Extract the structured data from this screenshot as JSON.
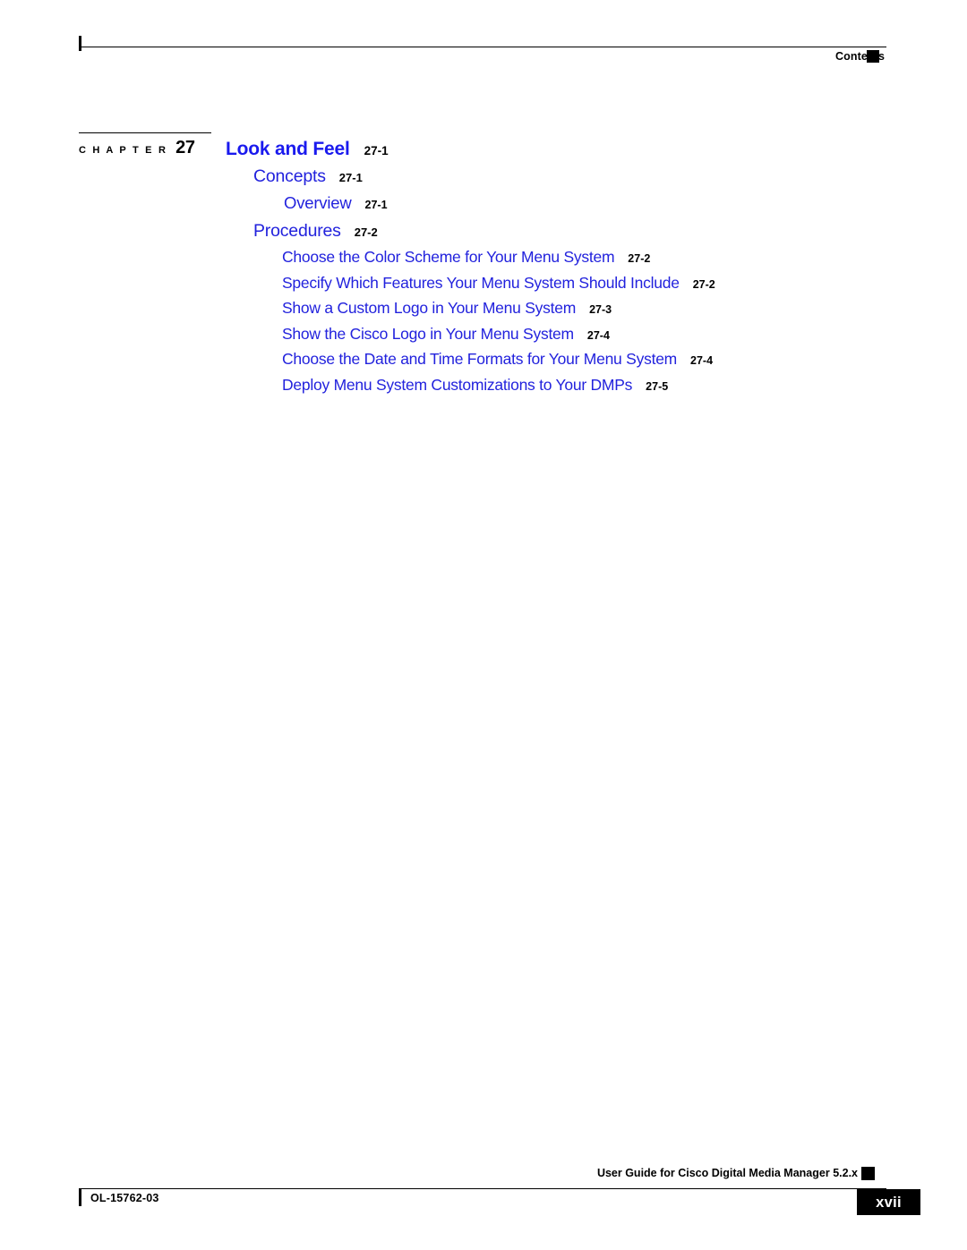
{
  "header": {
    "label": "Contents",
    "marker": "black-square"
  },
  "chapter": {
    "word": "C H A P T E R",
    "number": "27"
  },
  "toc": {
    "entries": [
      {
        "level": 1,
        "title": "Look and Feel",
        "page": "27-1"
      },
      {
        "level": 2,
        "title": "Concepts",
        "page": "27-1"
      },
      {
        "level": 3,
        "title": "Overview",
        "page": "27-1"
      },
      {
        "level": 2,
        "title": "Procedures",
        "page": "27-2"
      },
      {
        "level": 3,
        "title": "Choose the Color Scheme for Your Menu System",
        "page": "27-2"
      },
      {
        "level": 3,
        "title": "Specify Which Features Your Menu System Should Include",
        "page": "27-2"
      },
      {
        "level": 3,
        "title": "Show a Custom Logo in Your Menu System",
        "page": "27-3"
      },
      {
        "level": 3,
        "title": "Show the Cisco Logo in Your Menu System",
        "page": "27-4"
      },
      {
        "level": 3,
        "title": "Choose the Date and Time Formats for Your Menu System",
        "page": "27-4"
      },
      {
        "level": 3,
        "title": "Deploy Menu System Customizations to Your DMPs",
        "page": "27-5"
      }
    ]
  },
  "footer": {
    "guide_title": "User Guide for Cisco Digital Media Manager 5.2.x",
    "doc_id": "OL-15762-03",
    "page_number": "xvii"
  },
  "colors": {
    "link_blue": "#2222dd",
    "heading_blue": "#1a1aee",
    "text_black": "#000000",
    "page_white": "#ffffff"
  }
}
